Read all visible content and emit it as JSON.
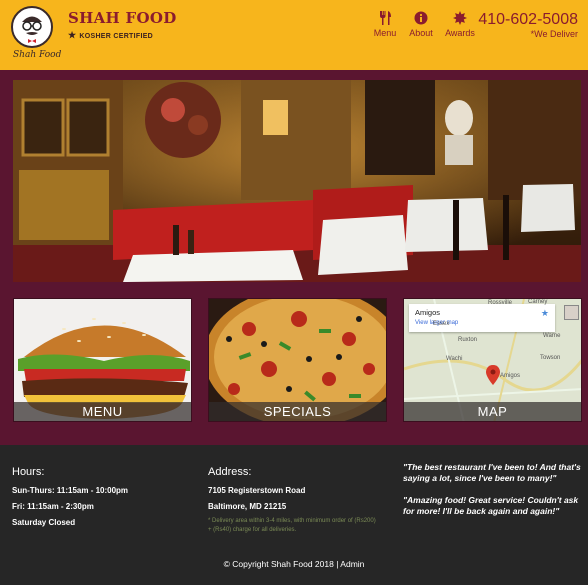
{
  "header": {
    "brand": "SHAH FOOD",
    "tagline": "KOSHER CERTIFIED",
    "logo_script": "Shah Food",
    "nav": [
      {
        "label": "Menu",
        "icon": "utensils-icon"
      },
      {
        "label": "About",
        "icon": "info-icon"
      },
      {
        "label": "Awards",
        "icon": "award-icon"
      }
    ],
    "phone": "410-602-5008",
    "deliver": "*We Deliver",
    "colors": {
      "bar": "#f7b51c",
      "accent": "#8a1c2e"
    }
  },
  "tiles": [
    {
      "label": "MENU"
    },
    {
      "label": "SPECIALS"
    },
    {
      "label": "MAP"
    }
  ],
  "map": {
    "place": "Amigos",
    "link": "View larger map",
    "pin_label": "Amigos",
    "towns": [
      "Essex",
      "Rossville",
      "Carney",
      "Ruxton",
      "Warne",
      "Towson",
      "Wachi",
      "Baltimore"
    ]
  },
  "footer": {
    "hours_title": "Hours:",
    "hours": [
      "Sun-Thurs: 11:15am - 10:00pm",
      "Fri: 11:15am - 2:30pm",
      "Saturday Closed"
    ],
    "address_title": "Address:",
    "address": [
      "7105 Registerstown Road",
      "Baltimore, MD 21215"
    ],
    "delivery_note": "* Delivery area within 3-4 miles, with minimum order of (Rs200) + (Rs40) charge for all deliveries.",
    "quotes": [
      "\"The best restaurant I've been to! And that's saying a lot, since I've been to many!\"",
      "\"Amazing food! Great service! Couldn't ask for more! I'll be back again and again!\""
    ],
    "copyright": "© Copyright Shah Food 2018 | Admin"
  }
}
